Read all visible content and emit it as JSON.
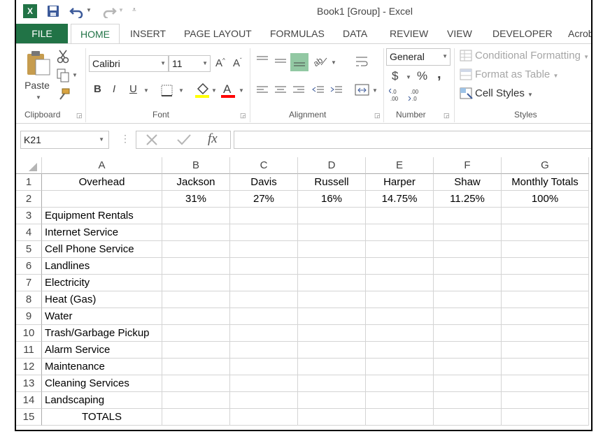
{
  "window": {
    "title": "Book1  [Group] - Excel"
  },
  "qat": {
    "app_icon": "excel-icon",
    "save": "save-icon",
    "undo": "undo-icon",
    "redo": "redo-icon",
    "customize": "customize-icon"
  },
  "tabs": [
    {
      "label": "FILE"
    },
    {
      "label": "HOME"
    },
    {
      "label": "INSERT"
    },
    {
      "label": "PAGE LAYOUT"
    },
    {
      "label": "FORMULAS"
    },
    {
      "label": "DATA"
    },
    {
      "label": "REVIEW"
    },
    {
      "label": "VIEW"
    },
    {
      "label": "DEVELOPER"
    },
    {
      "label": "Acrob"
    }
  ],
  "ribbon": {
    "clipboard": {
      "label": "Clipboard",
      "paste": "Paste"
    },
    "font": {
      "label": "Font",
      "name": "Calibri",
      "size": "11",
      "bold": "B",
      "italic": "I",
      "underline": "U"
    },
    "alignment": {
      "label": "Alignment"
    },
    "number": {
      "label": "Number",
      "format": "General",
      "currency": "$",
      "percent": "%",
      "comma": ","
    },
    "styles": {
      "label": "Styles",
      "conditional": "Conditional Formatting",
      "format_table": "Format as Table",
      "cell_styles": "Cell Styles"
    }
  },
  "formula_bar": {
    "name_box": "K21",
    "fx": "fx",
    "value": ""
  },
  "colors": {
    "excel_green": "#217346",
    "grid_line": "#d4d4d4",
    "highlight": "#ffff00",
    "font_red": "#ff0000"
  },
  "sheet": {
    "columns": [
      "A",
      "B",
      "C",
      "D",
      "E",
      "F",
      "G"
    ],
    "rows": [
      {
        "num": "1",
        "cells": [
          "Overhead",
          "Jackson",
          "Davis",
          "Russell",
          "Harper",
          "Shaw",
          "Monthly Totals"
        ]
      },
      {
        "num": "2",
        "cells": [
          "",
          "31%",
          "27%",
          "16%",
          "14.75%",
          "11.25%",
          "100%"
        ]
      },
      {
        "num": "3",
        "cells": [
          "Equipment Rentals",
          "",
          "",
          "",
          "",
          "",
          ""
        ]
      },
      {
        "num": "4",
        "cells": [
          "Internet Service",
          "",
          "",
          "",
          "",
          "",
          ""
        ]
      },
      {
        "num": "5",
        "cells": [
          "Cell Phone Service",
          "",
          "",
          "",
          "",
          "",
          ""
        ]
      },
      {
        "num": "6",
        "cells": [
          "Landlines",
          "",
          "",
          "",
          "",
          "",
          ""
        ]
      },
      {
        "num": "7",
        "cells": [
          "Electricity",
          "",
          "",
          "",
          "",
          "",
          ""
        ]
      },
      {
        "num": "8",
        "cells": [
          "Heat (Gas)",
          "",
          "",
          "",
          "",
          "",
          ""
        ]
      },
      {
        "num": "9",
        "cells": [
          "Water",
          "",
          "",
          "",
          "",
          "",
          ""
        ]
      },
      {
        "num": "10",
        "cells": [
          "Trash/Garbage Pickup",
          "",
          "",
          "",
          "",
          "",
          ""
        ]
      },
      {
        "num": "11",
        "cells": [
          "Alarm Service",
          "",
          "",
          "",
          "",
          "",
          ""
        ]
      },
      {
        "num": "12",
        "cells": [
          "Maintenance",
          "",
          "",
          "",
          "",
          "",
          ""
        ]
      },
      {
        "num": "13",
        "cells": [
          "Cleaning Services",
          "",
          "",
          "",
          "",
          "",
          ""
        ]
      },
      {
        "num": "14",
        "cells": [
          "Landscaping",
          "",
          "",
          "",
          "",
          "",
          ""
        ]
      },
      {
        "num": "15",
        "cells": [
          "TOTALS",
          "",
          "",
          "",
          "",
          "",
          ""
        ]
      }
    ]
  }
}
